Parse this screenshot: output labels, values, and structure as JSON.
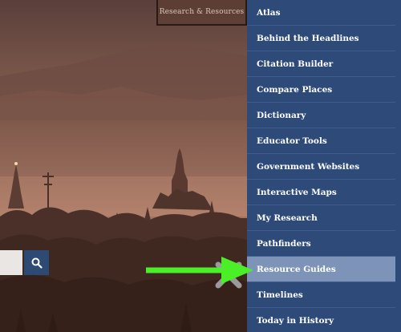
{
  "header": {
    "research_tab_label": "Research & Resources"
  },
  "search": {
    "value": "",
    "button_icon": "search-icon"
  },
  "menu": {
    "items": [
      {
        "label": "Atlas"
      },
      {
        "label": "Behind the Headlines"
      },
      {
        "label": "Citation Builder"
      },
      {
        "label": "Compare Places"
      },
      {
        "label": "Dictionary"
      },
      {
        "label": "Educator Tools"
      },
      {
        "label": "Government Websites"
      },
      {
        "label": "Interactive Maps"
      },
      {
        "label": "My Research"
      },
      {
        "label": "Pathfinders"
      },
      {
        "label": "Resource Guides",
        "highlighted": true
      },
      {
        "label": "Timelines"
      },
      {
        "label": "Today in History"
      }
    ]
  },
  "colors": {
    "menu_background": "#2d4a79",
    "menu_highlight": "#7d94b8",
    "arrow": "#4bef27",
    "search_button": "#2c4a74"
  }
}
